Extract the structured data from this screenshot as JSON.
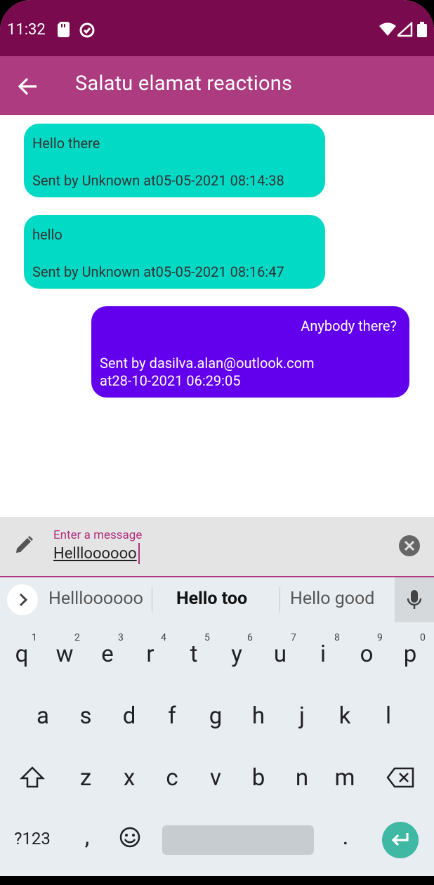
{
  "status": {
    "time": "11:32"
  },
  "appbar": {
    "title": "Salatu elamat reactions"
  },
  "messages": [
    {
      "text": "Hello there",
      "meta": "Sent by Unknown at05-05-2021 08:14:38"
    },
    {
      "text": "hello",
      "meta": "Sent by Unknown at05-05-2021 08:16:47"
    },
    {
      "text": "Anybody there?",
      "meta_line1": "Sent by dasilva.alan@outlook.com",
      "meta_line2": "at28-10-2021 06:29:05"
    }
  ],
  "compose": {
    "label": "Enter a message",
    "value": "Hellloooooo"
  },
  "keyboard": {
    "suggestions": [
      "Hellloooooo",
      "Hello too",
      "Hello good"
    ],
    "row1": [
      "q",
      "w",
      "e",
      "r",
      "t",
      "y",
      "u",
      "i",
      "o",
      "p"
    ],
    "row1_nums": [
      "1",
      "2",
      "3",
      "4",
      "5",
      "6",
      "7",
      "8",
      "9",
      "0"
    ],
    "row2": [
      "a",
      "s",
      "d",
      "f",
      "g",
      "h",
      "j",
      "k",
      "l"
    ],
    "row3": [
      "z",
      "x",
      "c",
      "v",
      "b",
      "n",
      "m"
    ],
    "sym": "?123",
    "comma": ",",
    "period": "."
  },
  "colors": {
    "statusbar": "#7a0a4e",
    "appbar": "#ad3b80",
    "incoming": "#03dac6",
    "outgoing": "#6200ee",
    "enter": "#3fb8a4"
  }
}
